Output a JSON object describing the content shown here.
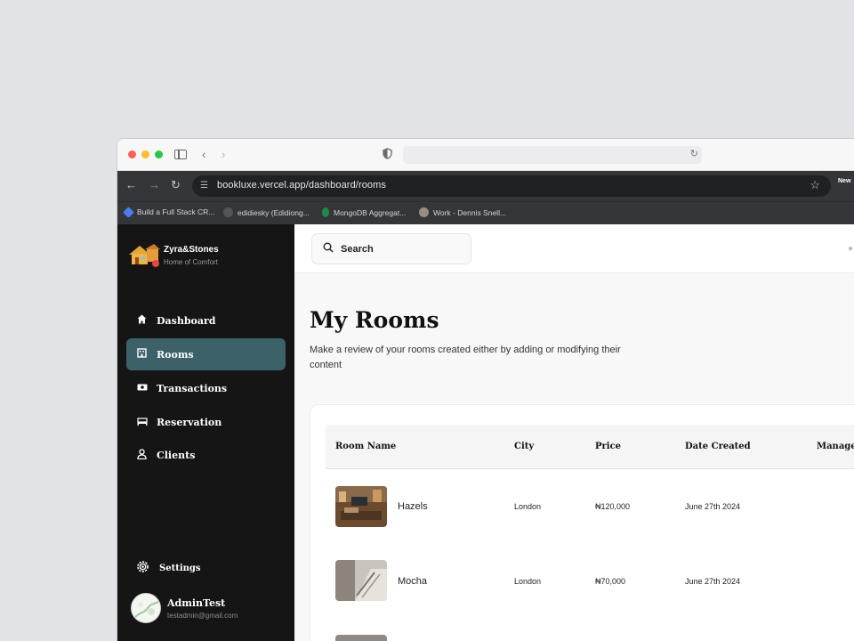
{
  "browser": {
    "url": "bookluxe.vercel.app/dashboard/rooms",
    "extension_label": "New",
    "bookmarks": [
      {
        "label": "Build a Full Stack CR...",
        "color": "#4b7bf5"
      },
      {
        "label": "edidiesky (Edidiong...",
        "color": "#555555"
      },
      {
        "label": "MongoDB Aggregat...",
        "color": "#1e8a46"
      },
      {
        "label": "Work - Dennis Snell...",
        "color": "#9a8c80"
      }
    ]
  },
  "sidebar": {
    "brand_name": "Zyra&Stones",
    "brand_tagline": "Home of Comfort",
    "items": [
      {
        "label": "Dashboard",
        "icon": "home-icon"
      },
      {
        "label": "Rooms",
        "icon": "building-icon"
      },
      {
        "label": "Transactions",
        "icon": "cash-icon"
      },
      {
        "label": "Reservation",
        "icon": "bed-icon"
      },
      {
        "label": "Clients",
        "icon": "user-icon"
      }
    ],
    "active_item": "Rooms",
    "settings_label": "Settings",
    "user": {
      "name": "AdminTest",
      "email": "testadmin@gmail.com"
    }
  },
  "search": {
    "placeholder": "Search"
  },
  "page": {
    "title": "My Rooms",
    "description": "Make a review of your rooms created either by adding or modifying their content"
  },
  "table": {
    "columns": [
      "Room Name",
      "City",
      "Price",
      "Date Created",
      "Manage"
    ],
    "rows": [
      {
        "name": "Hazels",
        "city": "London",
        "price": "₦120,000",
        "date": "June 27th 2024"
      },
      {
        "name": "Mocha",
        "city": "London",
        "price": "₦70,000",
        "date": "June 27th 2024"
      }
    ]
  },
  "colors": {
    "sidebar_bg": "#151515",
    "active_item_bg": "#3d6168",
    "main_bg": "#f8f8f8"
  }
}
